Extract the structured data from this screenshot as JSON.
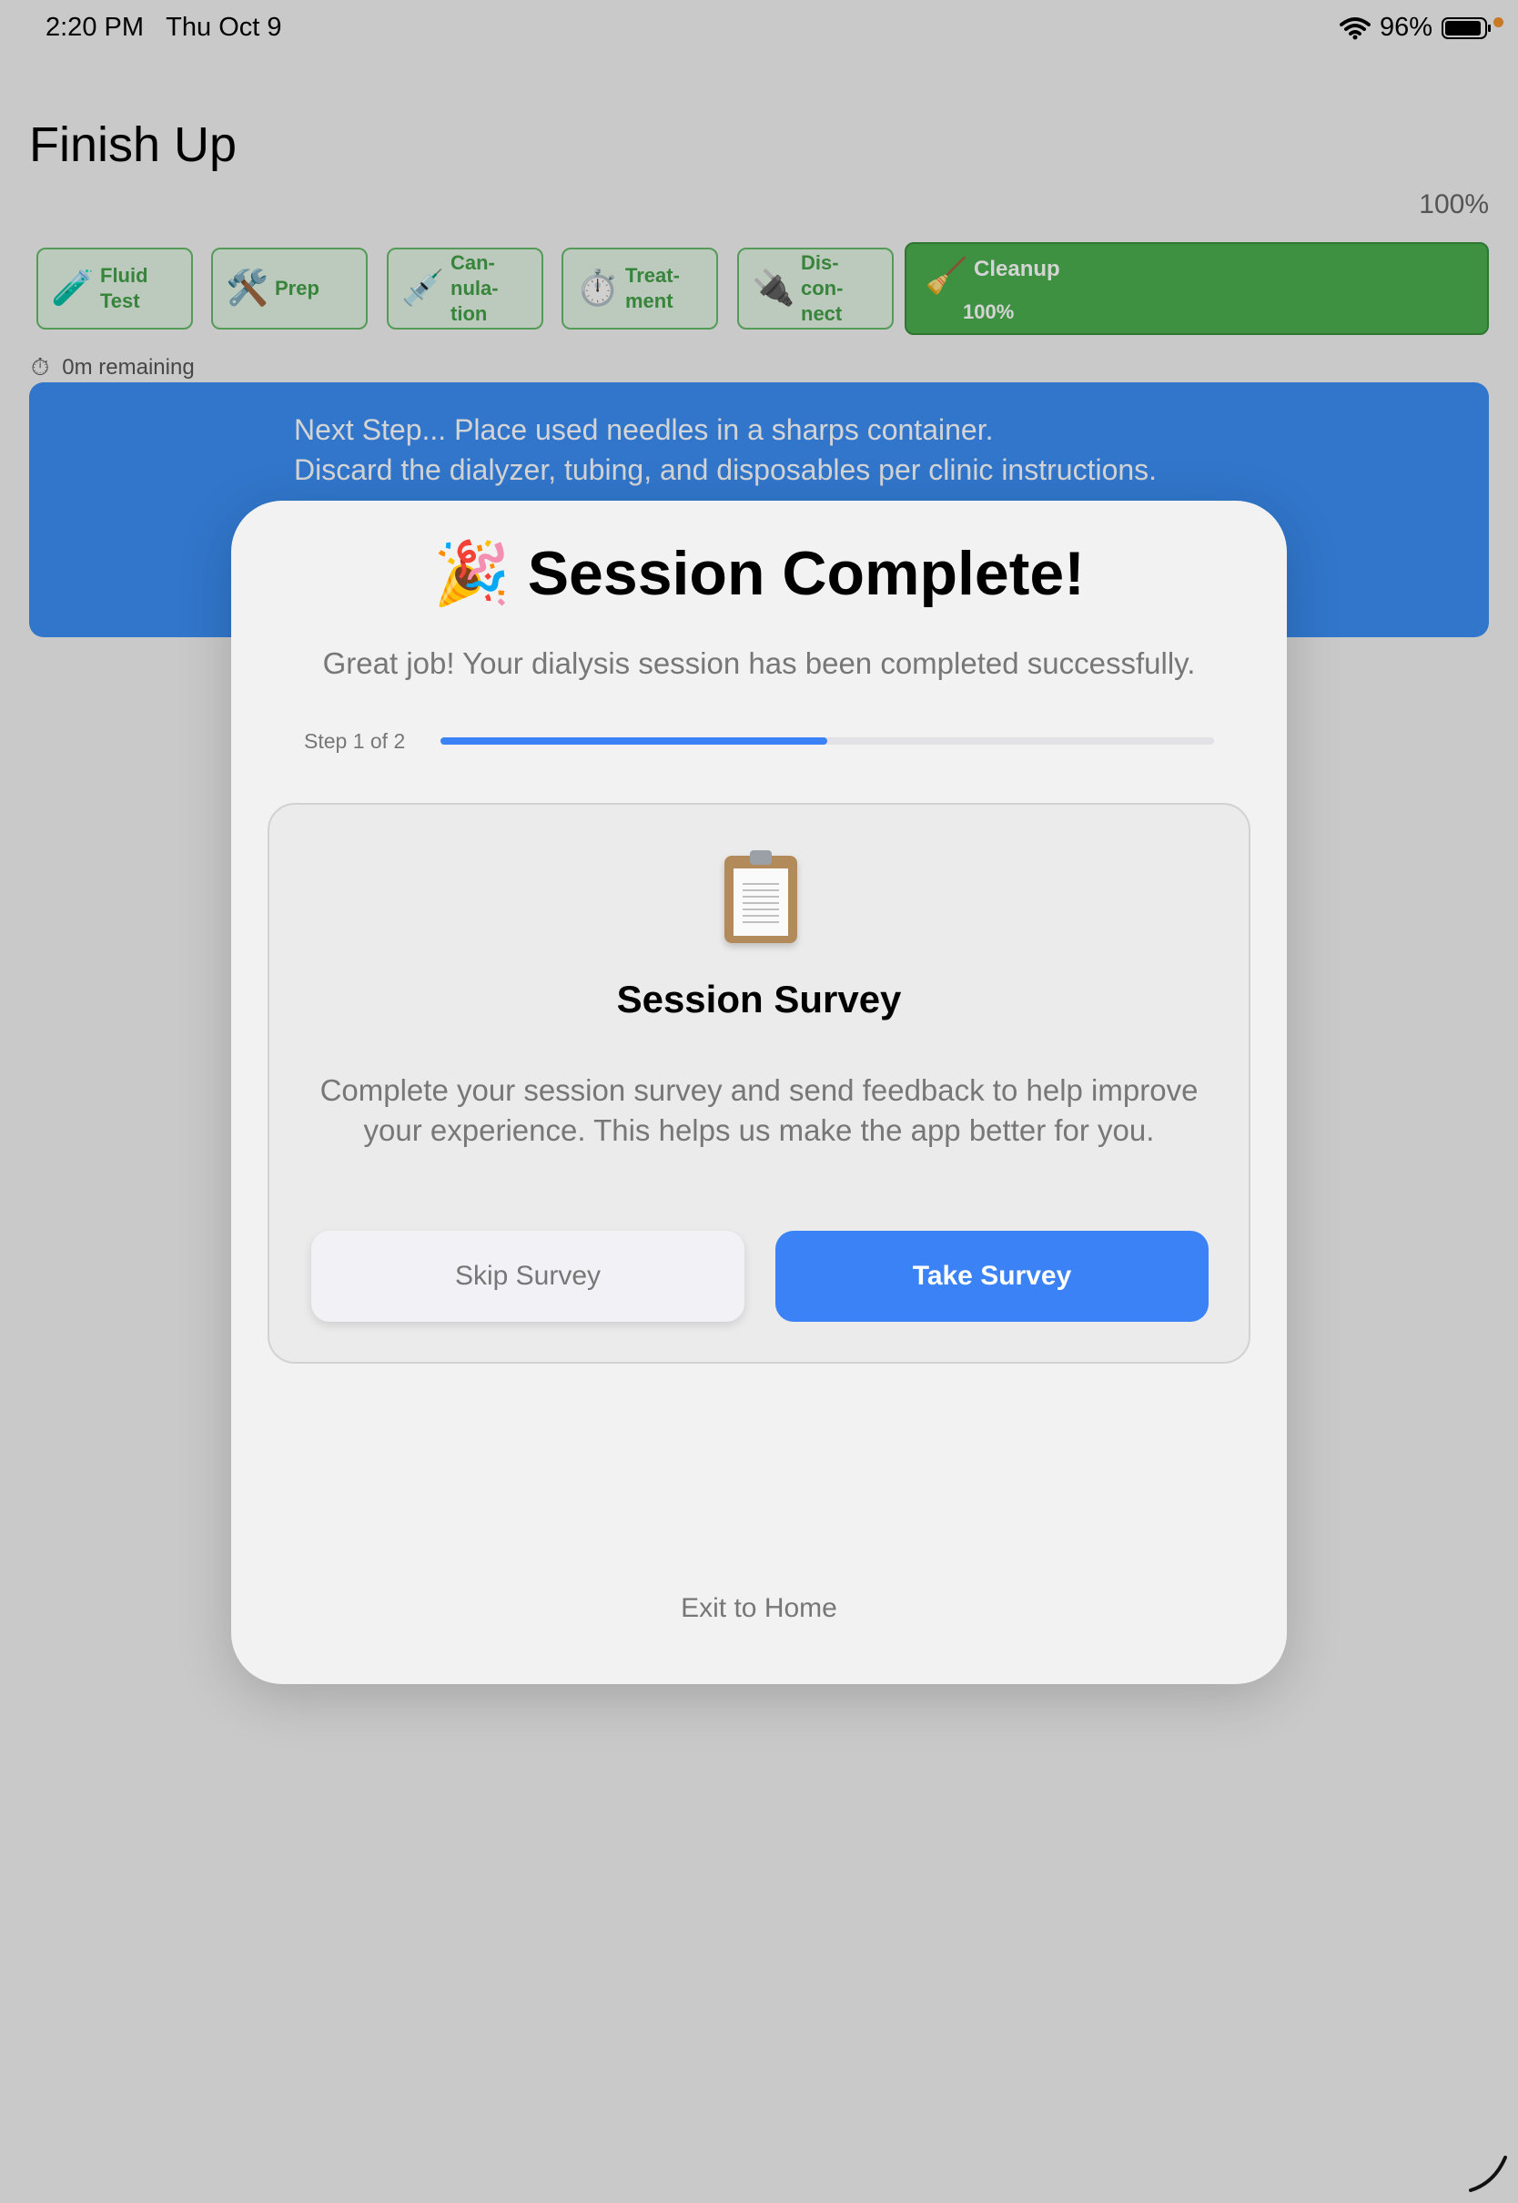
{
  "status_bar": {
    "time": "2:20 PM",
    "date": "Thu Oct 9",
    "battery": "96%"
  },
  "page": {
    "title": "Finish Up",
    "overall_progress": "100%"
  },
  "steps": [
    {
      "label": "Fluid\nTest",
      "icon": "test-tube-icon",
      "glyph": "🧪",
      "status": "done"
    },
    {
      "label": "Prep",
      "icon": "hammer-wrench-icon",
      "glyph": "🛠️",
      "status": "done"
    },
    {
      "label": "Can-\nnula-\ntion",
      "icon": "syringe-icon",
      "glyph": "💉",
      "status": "done"
    },
    {
      "label": "Treat-\nment",
      "icon": "stopwatch-icon",
      "glyph": "⏱️",
      "status": "done"
    },
    {
      "label": "Dis-\ncon-\nnect",
      "icon": "plug-icon",
      "glyph": "🔌",
      "status": "done"
    },
    {
      "label": "Cleanup",
      "icon": "broom-icon",
      "glyph": "🧹",
      "status": "active",
      "percent": "100%"
    }
  ],
  "timer": {
    "remaining": "0m remaining"
  },
  "next_step": {
    "text": "Next Step... Place used needles in a sharps container.\nDiscard the dialyzer, tubing, and disposables per clinic instructions."
  },
  "modal": {
    "title": "🎉 Session Complete!",
    "subtitle": "Great job! Your dialysis session has been completed successfully.",
    "step_label": "Step 1 of 2",
    "progress_fraction": 0.5,
    "survey": {
      "icon": "clipboard-icon",
      "title": "Session Survey",
      "description": "Complete your session survey and send feedback to help improve your experience. This helps us make the app better for you.",
      "skip_label": "Skip Survey",
      "take_label": "Take Survey"
    },
    "exit_label": "Exit to Home"
  },
  "colors": {
    "accent_blue": "#3b82f6",
    "step_green": "#4caf50",
    "next_card_blue": "#3b8ff5"
  }
}
